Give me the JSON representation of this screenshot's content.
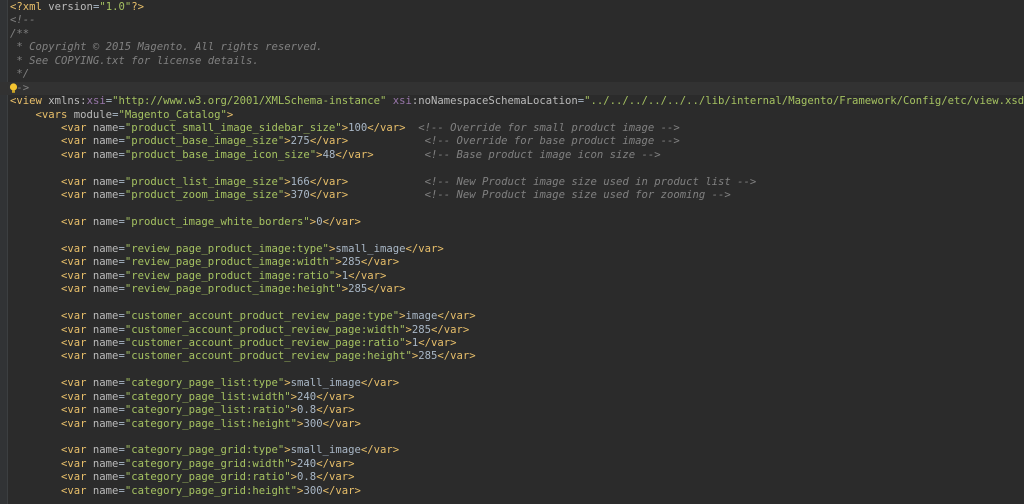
{
  "editor": {
    "language": "xml",
    "colors": {
      "background": "#2b2b2b",
      "text": "#a9b7c6",
      "tag": "#e8bf6a",
      "attribute": "#bababa",
      "namespace": "#9876aa",
      "string": "#a5c261",
      "comment": "#808080",
      "pi": "#e8bf6a"
    },
    "lines": [
      [
        {
          "t": "pi",
          "v": "<?xml "
        },
        {
          "t": "attr",
          "v": "version"
        },
        {
          "t": "txt",
          "v": "="
        },
        {
          "t": "str",
          "v": "\"1.0\""
        },
        {
          "t": "pi",
          "v": "?>"
        }
      ],
      [
        {
          "t": "com",
          "v": "<!--"
        }
      ],
      [
        {
          "t": "com",
          "v": "/**"
        }
      ],
      [
        {
          "t": "com",
          "v": " * Copyright © 2015 Magento. All rights reserved."
        }
      ],
      [
        {
          "t": "com",
          "v": " * See COPYING.txt for license details."
        }
      ],
      [
        {
          "t": "com",
          "v": " */"
        }
      ],
      [
        {
          "t": "com",
          "v": "-->"
        }
      ],
      [
        {
          "t": "tag",
          "v": "<view "
        },
        {
          "t": "attr",
          "v": "xmlns:"
        },
        {
          "t": "ns",
          "v": "xsi"
        },
        {
          "t": "txt",
          "v": "="
        },
        {
          "t": "str",
          "v": "\"http://www.w3.org/2001/XMLSchema-instance\" "
        },
        {
          "t": "ns",
          "v": "xsi"
        },
        {
          "t": "attr",
          "v": ":noNamespaceSchemaLocation"
        },
        {
          "t": "txt",
          "v": "="
        },
        {
          "t": "str",
          "v": "\"../../../../../../lib/internal/Magento/Framework/Config/etc/view.xsd\""
        },
        {
          "t": "tag",
          "v": ">"
        }
      ],
      [
        {
          "t": "txt",
          "v": "    "
        },
        {
          "t": "tag",
          "v": "<vars "
        },
        {
          "t": "attr",
          "v": "module"
        },
        {
          "t": "txt",
          "v": "="
        },
        {
          "t": "str",
          "v": "\"Magento_Catalog\""
        },
        {
          "t": "tag",
          "v": ">"
        }
      ],
      [
        {
          "t": "txt",
          "v": "        "
        },
        {
          "t": "tag",
          "v": "<var "
        },
        {
          "t": "attr",
          "v": "name"
        },
        {
          "t": "txt",
          "v": "="
        },
        {
          "t": "str",
          "v": "\"product_small_image_sidebar_size\""
        },
        {
          "t": "tag",
          "v": ">"
        },
        {
          "t": "txt",
          "v": "100"
        },
        {
          "t": "tag",
          "v": "</var>"
        },
        {
          "t": "txt",
          "v": "  "
        },
        {
          "t": "com",
          "v": "<!-- Override for small product image -->"
        }
      ],
      [
        {
          "t": "txt",
          "v": "        "
        },
        {
          "t": "tag",
          "v": "<var "
        },
        {
          "t": "attr",
          "v": "name"
        },
        {
          "t": "txt",
          "v": "="
        },
        {
          "t": "str",
          "v": "\"product_base_image_size\""
        },
        {
          "t": "tag",
          "v": ">"
        },
        {
          "t": "txt",
          "v": "275"
        },
        {
          "t": "tag",
          "v": "</var>"
        },
        {
          "t": "txt",
          "v": "            "
        },
        {
          "t": "com",
          "v": "<!-- Override for base product image -->"
        }
      ],
      [
        {
          "t": "txt",
          "v": "        "
        },
        {
          "t": "tag",
          "v": "<var "
        },
        {
          "t": "attr",
          "v": "name"
        },
        {
          "t": "txt",
          "v": "="
        },
        {
          "t": "str",
          "v": "\"product_base_image_icon_size\""
        },
        {
          "t": "tag",
          "v": ">"
        },
        {
          "t": "txt",
          "v": "48"
        },
        {
          "t": "tag",
          "v": "</var>"
        },
        {
          "t": "txt",
          "v": "        "
        },
        {
          "t": "com",
          "v": "<!-- Base product image icon size -->"
        }
      ],
      [],
      [
        {
          "t": "txt",
          "v": "        "
        },
        {
          "t": "tag",
          "v": "<var "
        },
        {
          "t": "attr",
          "v": "name"
        },
        {
          "t": "txt",
          "v": "="
        },
        {
          "t": "str",
          "v": "\"product_list_image_size\""
        },
        {
          "t": "tag",
          "v": ">"
        },
        {
          "t": "txt",
          "v": "166"
        },
        {
          "t": "tag",
          "v": "</var>"
        },
        {
          "t": "txt",
          "v": "            "
        },
        {
          "t": "com",
          "v": "<!-- New Product image size used in product list -->"
        }
      ],
      [
        {
          "t": "txt",
          "v": "        "
        },
        {
          "t": "tag",
          "v": "<var "
        },
        {
          "t": "attr",
          "v": "name"
        },
        {
          "t": "txt",
          "v": "="
        },
        {
          "t": "str",
          "v": "\"product_zoom_image_size\""
        },
        {
          "t": "tag",
          "v": ">"
        },
        {
          "t": "txt",
          "v": "370"
        },
        {
          "t": "tag",
          "v": "</var>"
        },
        {
          "t": "txt",
          "v": "            "
        },
        {
          "t": "com",
          "v": "<!-- New Product image size used for zooming -->"
        }
      ],
      [],
      [
        {
          "t": "txt",
          "v": "        "
        },
        {
          "t": "tag",
          "v": "<var "
        },
        {
          "t": "attr",
          "v": "name"
        },
        {
          "t": "txt",
          "v": "="
        },
        {
          "t": "str",
          "v": "\"product_image_white_borders\""
        },
        {
          "t": "tag",
          "v": ">"
        },
        {
          "t": "txt",
          "v": "0"
        },
        {
          "t": "tag",
          "v": "</var>"
        }
      ],
      [],
      [
        {
          "t": "txt",
          "v": "        "
        },
        {
          "t": "tag",
          "v": "<var "
        },
        {
          "t": "attr",
          "v": "name"
        },
        {
          "t": "txt",
          "v": "="
        },
        {
          "t": "str",
          "v": "\"review_page_product_image:type\""
        },
        {
          "t": "tag",
          "v": ">"
        },
        {
          "t": "txt",
          "v": "small_image"
        },
        {
          "t": "tag",
          "v": "</var>"
        }
      ],
      [
        {
          "t": "txt",
          "v": "        "
        },
        {
          "t": "tag",
          "v": "<var "
        },
        {
          "t": "attr",
          "v": "name"
        },
        {
          "t": "txt",
          "v": "="
        },
        {
          "t": "str",
          "v": "\"review_page_product_image:width\""
        },
        {
          "t": "tag",
          "v": ">"
        },
        {
          "t": "txt",
          "v": "285"
        },
        {
          "t": "tag",
          "v": "</var>"
        }
      ],
      [
        {
          "t": "txt",
          "v": "        "
        },
        {
          "t": "tag",
          "v": "<var "
        },
        {
          "t": "attr",
          "v": "name"
        },
        {
          "t": "txt",
          "v": "="
        },
        {
          "t": "str",
          "v": "\"review_page_product_image:ratio\""
        },
        {
          "t": "tag",
          "v": ">"
        },
        {
          "t": "txt",
          "v": "1"
        },
        {
          "t": "tag",
          "v": "</var>"
        }
      ],
      [
        {
          "t": "txt",
          "v": "        "
        },
        {
          "t": "tag",
          "v": "<var "
        },
        {
          "t": "attr",
          "v": "name"
        },
        {
          "t": "txt",
          "v": "="
        },
        {
          "t": "str",
          "v": "\"review_page_product_image:height\""
        },
        {
          "t": "tag",
          "v": ">"
        },
        {
          "t": "txt",
          "v": "285"
        },
        {
          "t": "tag",
          "v": "</var>"
        }
      ],
      [],
      [
        {
          "t": "txt",
          "v": "        "
        },
        {
          "t": "tag",
          "v": "<var "
        },
        {
          "t": "attr",
          "v": "name"
        },
        {
          "t": "txt",
          "v": "="
        },
        {
          "t": "str",
          "v": "\"customer_account_product_review_page:type\""
        },
        {
          "t": "tag",
          "v": ">"
        },
        {
          "t": "txt",
          "v": "image"
        },
        {
          "t": "tag",
          "v": "</var>"
        }
      ],
      [
        {
          "t": "txt",
          "v": "        "
        },
        {
          "t": "tag",
          "v": "<var "
        },
        {
          "t": "attr",
          "v": "name"
        },
        {
          "t": "txt",
          "v": "="
        },
        {
          "t": "str",
          "v": "\"customer_account_product_review_page:width\""
        },
        {
          "t": "tag",
          "v": ">"
        },
        {
          "t": "txt",
          "v": "285"
        },
        {
          "t": "tag",
          "v": "</var>"
        }
      ],
      [
        {
          "t": "txt",
          "v": "        "
        },
        {
          "t": "tag",
          "v": "<var "
        },
        {
          "t": "attr",
          "v": "name"
        },
        {
          "t": "txt",
          "v": "="
        },
        {
          "t": "str",
          "v": "\"customer_account_product_review_page:ratio\""
        },
        {
          "t": "tag",
          "v": ">"
        },
        {
          "t": "txt",
          "v": "1"
        },
        {
          "t": "tag",
          "v": "</var>"
        }
      ],
      [
        {
          "t": "txt",
          "v": "        "
        },
        {
          "t": "tag",
          "v": "<var "
        },
        {
          "t": "attr",
          "v": "name"
        },
        {
          "t": "txt",
          "v": "="
        },
        {
          "t": "str",
          "v": "\"customer_account_product_review_page:height\""
        },
        {
          "t": "tag",
          "v": ">"
        },
        {
          "t": "txt",
          "v": "285"
        },
        {
          "t": "tag",
          "v": "</var>"
        }
      ],
      [],
      [
        {
          "t": "txt",
          "v": "        "
        },
        {
          "t": "tag",
          "v": "<var "
        },
        {
          "t": "attr",
          "v": "name"
        },
        {
          "t": "txt",
          "v": "="
        },
        {
          "t": "str",
          "v": "\"category_page_list:type\""
        },
        {
          "t": "tag",
          "v": ">"
        },
        {
          "t": "txt",
          "v": "small_image"
        },
        {
          "t": "tag",
          "v": "</var>"
        }
      ],
      [
        {
          "t": "txt",
          "v": "        "
        },
        {
          "t": "tag",
          "v": "<var "
        },
        {
          "t": "attr",
          "v": "name"
        },
        {
          "t": "txt",
          "v": "="
        },
        {
          "t": "str",
          "v": "\"category_page_list:width\""
        },
        {
          "t": "tag",
          "v": ">"
        },
        {
          "t": "txt",
          "v": "240"
        },
        {
          "t": "tag",
          "v": "</var>"
        }
      ],
      [
        {
          "t": "txt",
          "v": "        "
        },
        {
          "t": "tag",
          "v": "<var "
        },
        {
          "t": "attr",
          "v": "name"
        },
        {
          "t": "txt",
          "v": "="
        },
        {
          "t": "str",
          "v": "\"category_page_list:ratio\""
        },
        {
          "t": "tag",
          "v": ">"
        },
        {
          "t": "txt",
          "v": "0.8"
        },
        {
          "t": "tag",
          "v": "</var>"
        }
      ],
      [
        {
          "t": "txt",
          "v": "        "
        },
        {
          "t": "tag",
          "v": "<var "
        },
        {
          "t": "attr",
          "v": "name"
        },
        {
          "t": "txt",
          "v": "="
        },
        {
          "t": "str",
          "v": "\"category_page_list:height\""
        },
        {
          "t": "tag",
          "v": ">"
        },
        {
          "t": "txt",
          "v": "300"
        },
        {
          "t": "tag",
          "v": "</var>"
        }
      ],
      [],
      [
        {
          "t": "txt",
          "v": "        "
        },
        {
          "t": "tag",
          "v": "<var "
        },
        {
          "t": "attr",
          "v": "name"
        },
        {
          "t": "txt",
          "v": "="
        },
        {
          "t": "str",
          "v": "\"category_page_grid:type\""
        },
        {
          "t": "tag",
          "v": ">"
        },
        {
          "t": "txt",
          "v": "small_image"
        },
        {
          "t": "tag",
          "v": "</var>"
        }
      ],
      [
        {
          "t": "txt",
          "v": "        "
        },
        {
          "t": "tag",
          "v": "<var "
        },
        {
          "t": "attr",
          "v": "name"
        },
        {
          "t": "txt",
          "v": "="
        },
        {
          "t": "str",
          "v": "\"category_page_grid:width\""
        },
        {
          "t": "tag",
          "v": ">"
        },
        {
          "t": "txt",
          "v": "240"
        },
        {
          "t": "tag",
          "v": "</var>"
        }
      ],
      [
        {
          "t": "txt",
          "v": "        "
        },
        {
          "t": "tag",
          "v": "<var "
        },
        {
          "t": "attr",
          "v": "name"
        },
        {
          "t": "txt",
          "v": "="
        },
        {
          "t": "str",
          "v": "\"category_page_grid:ratio\""
        },
        {
          "t": "tag",
          "v": ">"
        },
        {
          "t": "txt",
          "v": "0.8"
        },
        {
          "t": "tag",
          "v": "</var>"
        }
      ],
      [
        {
          "t": "txt",
          "v": "        "
        },
        {
          "t": "tag",
          "v": "<var "
        },
        {
          "t": "attr",
          "v": "name"
        },
        {
          "t": "txt",
          "v": "="
        },
        {
          "t": "str",
          "v": "\"category_page_grid:height\""
        },
        {
          "t": "tag",
          "v": ">"
        },
        {
          "t": "txt",
          "v": "300"
        },
        {
          "t": "tag",
          "v": "</var>"
        }
      ]
    ],
    "caret_line": 6,
    "gutter_icon": "lightbulb-icon"
  }
}
